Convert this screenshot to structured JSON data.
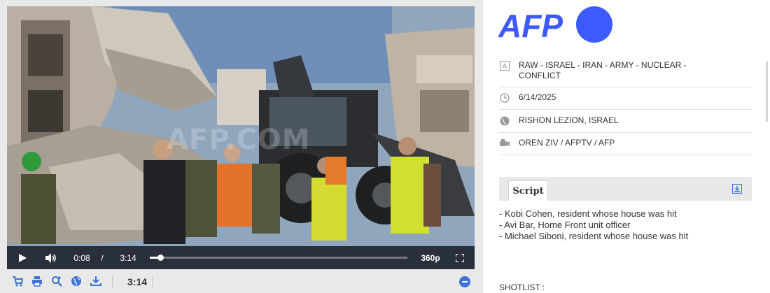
{
  "player": {
    "watermark": "AFP.COM",
    "current_time": "0:08",
    "separator": "/",
    "duration": "3:14",
    "progress_fraction": 0.04,
    "quality": "360p"
  },
  "toolbar": {
    "icons": [
      "cart-icon",
      "print-icon",
      "zoom-plus-icon",
      "globe-icon",
      "download-icon"
    ],
    "duration": "3:14"
  },
  "brand": {
    "logo_text": "AFP",
    "logo_color": "#3d5afe"
  },
  "meta": {
    "keywords": "RAW - ISRAEL - IRAN - ARMY - NUCLEAR - CONFLICT",
    "date": "6/14/2025",
    "location": "RISHON LEZION, ISRAEL",
    "credit": "OREN ZIV / AFPTV / AFP"
  },
  "script": {
    "tab_label": "Script",
    "lines": [
      "- Kobi Cohen, resident whose house was hit",
      "- Avi Bar, Home Front unit officer",
      "- Michael Siboni, resident whose house was hit"
    ],
    "shotlist_label": "SHOTLIST :"
  }
}
